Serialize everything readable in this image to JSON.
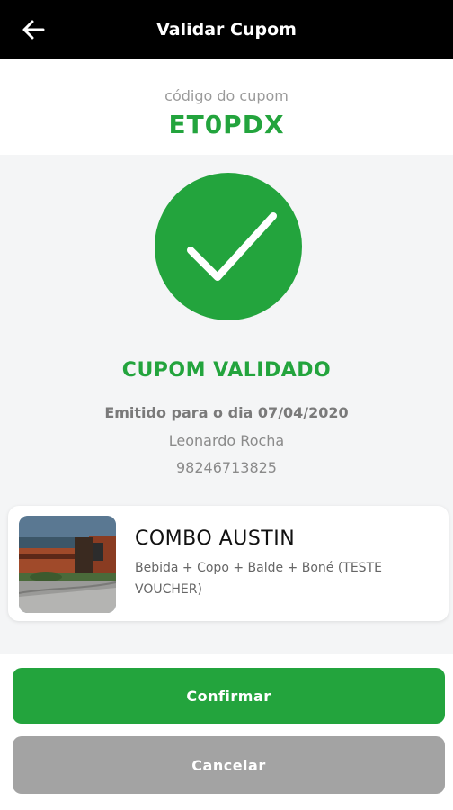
{
  "header": {
    "title": "Validar Cupom",
    "back_icon": "arrow-left-icon"
  },
  "coupon": {
    "code_label": "código do cupom",
    "code": "ET0PDX"
  },
  "status": {
    "icon": "checkmark-icon",
    "title": "CUPOM VALIDADO",
    "issued_text": "Emitido para o dia 07/04/2020",
    "customer_name": "Leonardo Rocha",
    "customer_phone": "98246713825"
  },
  "product": {
    "name": "COMBO AUSTIN",
    "description": "Bebida + Copo + Balde + Boné (TESTE VOUCHER)"
  },
  "actions": {
    "confirm_label": "Confirmar",
    "cancel_label": "Cancelar"
  },
  "colors": {
    "accent_green": "#23a43d",
    "header_bg": "#000000",
    "cancel_gray": "#a3a3a3",
    "background": "#f4f5f6"
  }
}
